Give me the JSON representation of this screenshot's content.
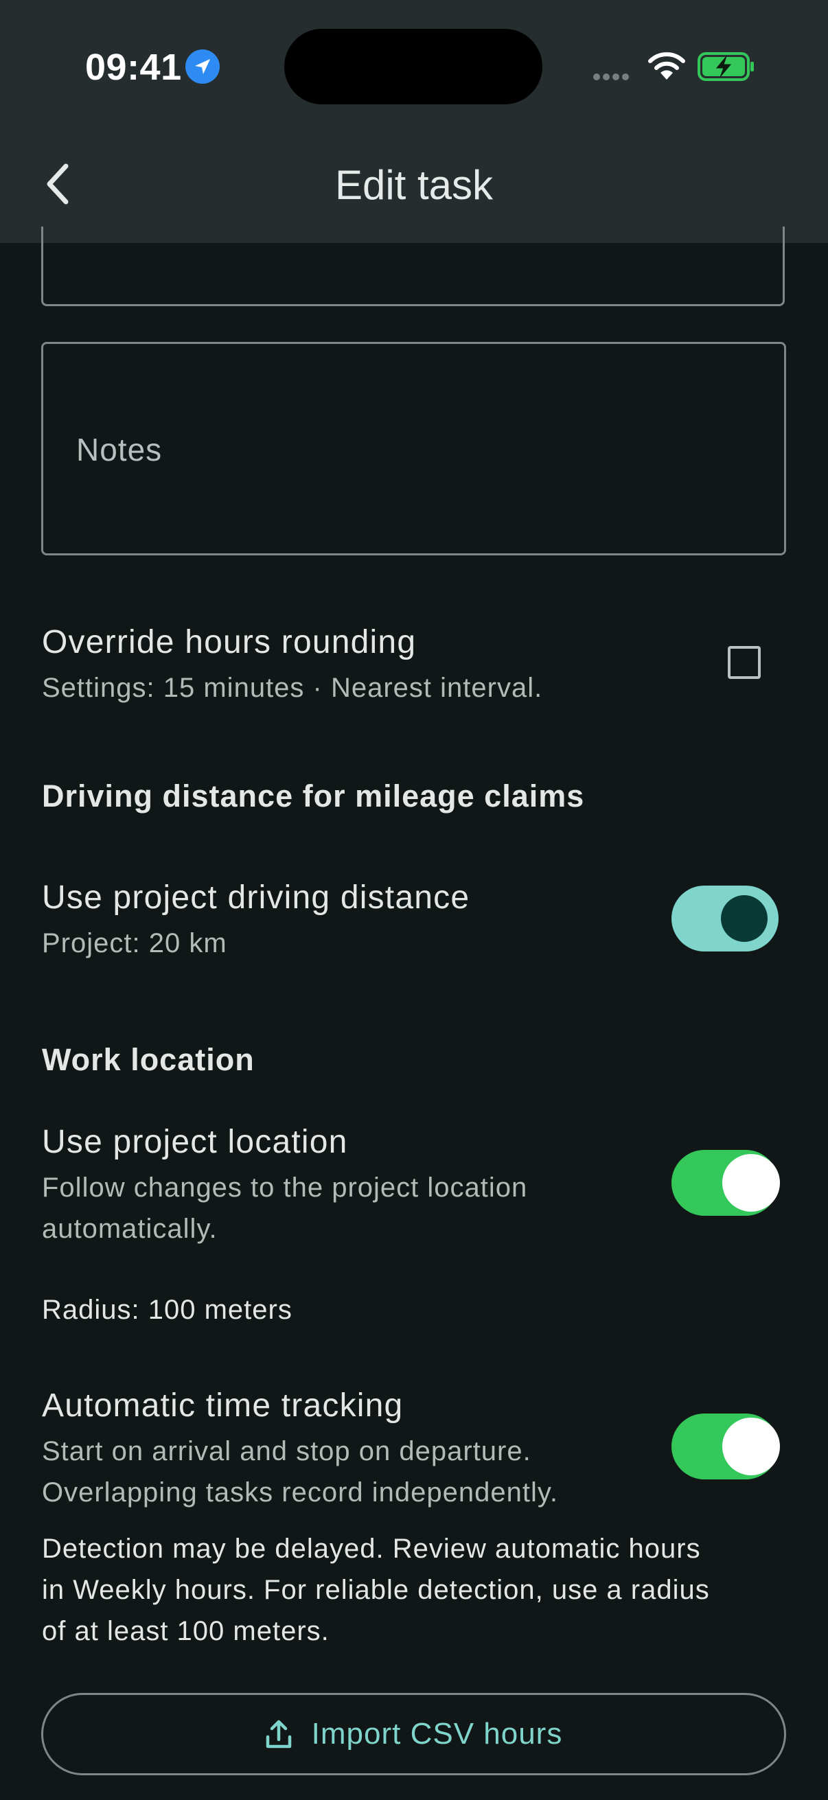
{
  "status_bar": {
    "time": "09:41"
  },
  "header": {
    "title": "Edit task"
  },
  "notes": {
    "placeholder": "Notes"
  },
  "override_rounding": {
    "title": "Override hours rounding",
    "subtitle": "Settings: 15 minutes · Nearest interval.",
    "checked": false
  },
  "driving_section": {
    "heading": "Driving distance for mileage claims",
    "use_project_distance": {
      "title": "Use project driving distance",
      "subtitle": "Project: 20 km",
      "enabled": true
    }
  },
  "work_location": {
    "heading": "Work location",
    "use_project_location": {
      "title": "Use project location",
      "subtitle_line1": "Follow changes to the project location",
      "subtitle_line2": "automatically.",
      "enabled": true
    },
    "radius": "Radius: 100 meters",
    "auto_tracking": {
      "title": "Automatic time tracking",
      "subtitle_line1": "Start on arrival and stop on departure.",
      "subtitle_line2": "Overlapping tasks record independently.",
      "enabled": true
    },
    "notice_line1": "Detection may be delayed. Review automatic hours",
    "notice_line2": "in Weekly hours. For reliable detection, use a radius",
    "notice_line3": "of at least 100 meters."
  },
  "import_button": {
    "label": "Import CSV hours"
  },
  "colors": {
    "accent": "#7fd5cb",
    "toggle_on": "#34c759",
    "background": "#111617",
    "header": "#252d2e"
  },
  "icons": {
    "back": "chevron-left-icon",
    "location": "location-arrow-icon",
    "wifi": "wifi-icon",
    "battery": "battery-charging-icon",
    "upload": "upload-icon"
  }
}
